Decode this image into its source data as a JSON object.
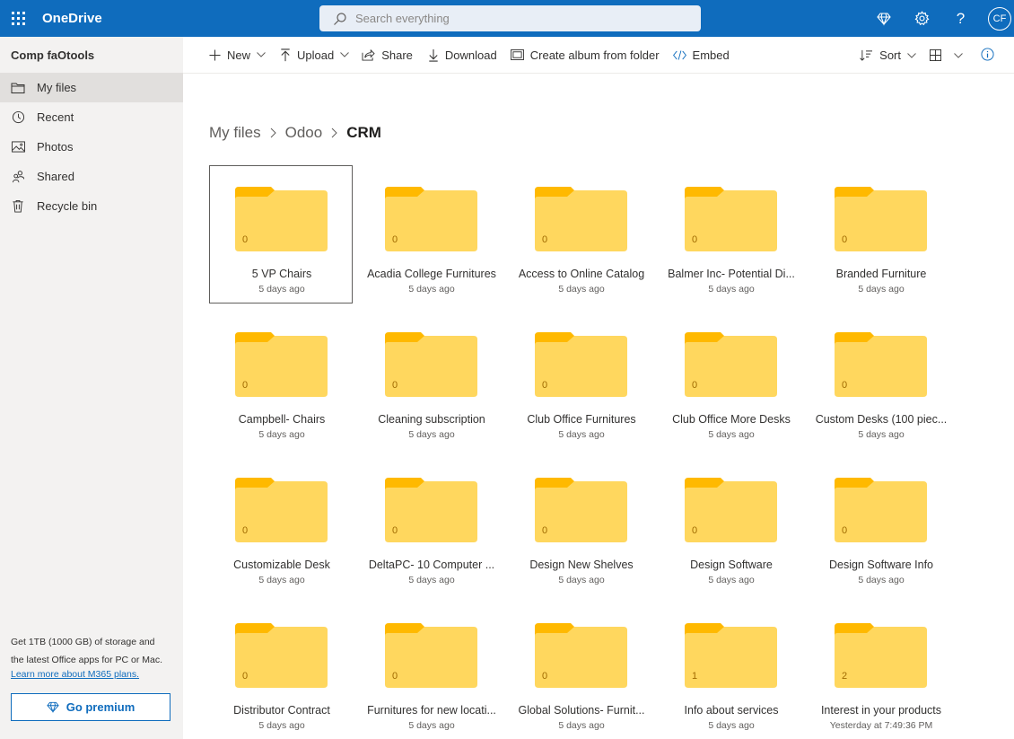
{
  "header": {
    "brand": "OneDrive",
    "search_placeholder": "Search everything",
    "avatar_initials": "CF"
  },
  "sidebar": {
    "account": "Comp faOtools",
    "items": [
      {
        "label": "My files",
        "icon": "folder-icon",
        "active": true
      },
      {
        "label": "Recent",
        "icon": "history-icon"
      },
      {
        "label": "Photos",
        "icon": "photo-icon"
      },
      {
        "label": "Shared",
        "icon": "people-icon"
      },
      {
        "label": "Recycle bin",
        "icon": "trash-icon"
      }
    ],
    "promo_line1": "Get 1TB (1000 GB) of storage and",
    "promo_line2": "the latest Office apps for PC or Mac.",
    "promo_link": "Learn more about M365 plans.",
    "premium_label": "Go premium"
  },
  "toolbar": {
    "new": "New",
    "upload": "Upload",
    "share": "Share",
    "download": "Download",
    "album": "Create album from folder",
    "embed": "Embed",
    "sort": "Sort"
  },
  "breadcrumb": {
    "items": [
      "My files",
      "Odoo"
    ],
    "current": "CRM"
  },
  "colors": {
    "brand_blue": "#0f6cbd",
    "folder_front": "#ffd75e",
    "folder_back": "#ffb900"
  },
  "folders": [
    {
      "name": "5 VP Chairs",
      "date": "5 days ago",
      "count": "0"
    },
    {
      "name": "Acadia College Furnitures",
      "date": "5 days ago",
      "count": "0"
    },
    {
      "name": "Access to Online Catalog",
      "date": "5 days ago",
      "count": "0"
    },
    {
      "name": "Balmer Inc- Potential Di...",
      "date": "5 days ago",
      "count": "0"
    },
    {
      "name": "Branded Furniture",
      "date": "5 days ago",
      "count": "0"
    },
    {
      "name": "Campbell- Chairs",
      "date": "5 days ago",
      "count": "0"
    },
    {
      "name": "Cleaning subscription",
      "date": "5 days ago",
      "count": "0"
    },
    {
      "name": "Club Office Furnitures",
      "date": "5 days ago",
      "count": "0"
    },
    {
      "name": "Club Office More Desks",
      "date": "5 days ago",
      "count": "0"
    },
    {
      "name": "Custom Desks (100 piec...",
      "date": "5 days ago",
      "count": "0"
    },
    {
      "name": "Customizable Desk",
      "date": "5 days ago",
      "count": "0"
    },
    {
      "name": "DeltaPC- 10 Computer ...",
      "date": "5 days ago",
      "count": "0"
    },
    {
      "name": "Design New Shelves",
      "date": "5 days ago",
      "count": "0"
    },
    {
      "name": "Design Software",
      "date": "5 days ago",
      "count": "0"
    },
    {
      "name": "Design Software Info",
      "date": "5 days ago",
      "count": "0"
    },
    {
      "name": "Distributor Contract",
      "date": "5 days ago",
      "count": "0"
    },
    {
      "name": "Furnitures for new locati...",
      "date": "5 days ago",
      "count": "0"
    },
    {
      "name": "Global Solutions- Furnit...",
      "date": "5 days ago",
      "count": "0"
    },
    {
      "name": "Info about services",
      "date": "5 days ago",
      "count": "1"
    },
    {
      "name": "Interest in your products",
      "date": "Yesterday at 7:49:36 PM",
      "count": "2"
    }
  ]
}
